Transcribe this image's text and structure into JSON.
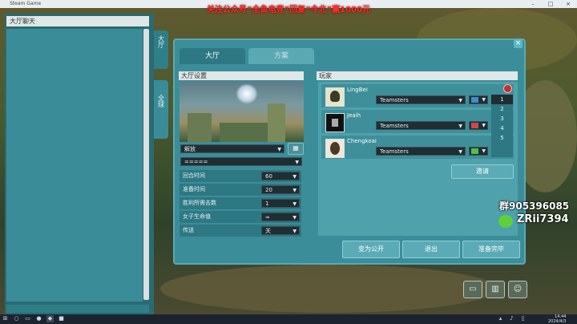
{
  "window": {
    "title": "Steam Game"
  },
  "banner": {
    "text": "关注公众号“全鱼电竞”回复“令北”赢1000元"
  },
  "chat": {
    "header": "大厅聊天"
  },
  "side_tabs": [
    {
      "label": "大厅"
    },
    {
      "label": "全球"
    }
  ],
  "dialog": {
    "close_label": "×",
    "tabs": [
      {
        "label": "大厅"
      },
      {
        "label": "方案"
      }
    ]
  },
  "settings": {
    "header": "大厅设置",
    "map_select": "解放",
    "mode_select": "=====",
    "rows": [
      {
        "label": "回合时间",
        "value": "60"
      },
      {
        "label": "准备时间",
        "value": "20"
      },
      {
        "label": "胜利所需击数",
        "value": "1"
      },
      {
        "label": "女子生命值",
        "value": "∞"
      },
      {
        "label": "传送",
        "value": "关"
      }
    ]
  },
  "players": {
    "header": "玩家",
    "list": [
      {
        "name": "LingBei",
        "team": "Teamsters",
        "color": "#3a8fd0"
      },
      {
        "name": "Jeaih",
        "team": "Teamsters",
        "color": "#d04848"
      },
      {
        "name": "Chengkoai",
        "team": "Teamsters",
        "color": "#4fc04a"
      }
    ],
    "slot_options": [
      "1",
      "2",
      "3",
      "4",
      "5"
    ],
    "slot_selected": "1",
    "invite_label": "邀请"
  },
  "actions": {
    "public_label": "变为公开",
    "exit_label": "退出",
    "ready_label": "准备完毕"
  },
  "watermark": {
    "group": "群905396085",
    "id": "ZRii7394"
  },
  "clock": {
    "time": "14:44",
    "date": "2024/4/3"
  }
}
